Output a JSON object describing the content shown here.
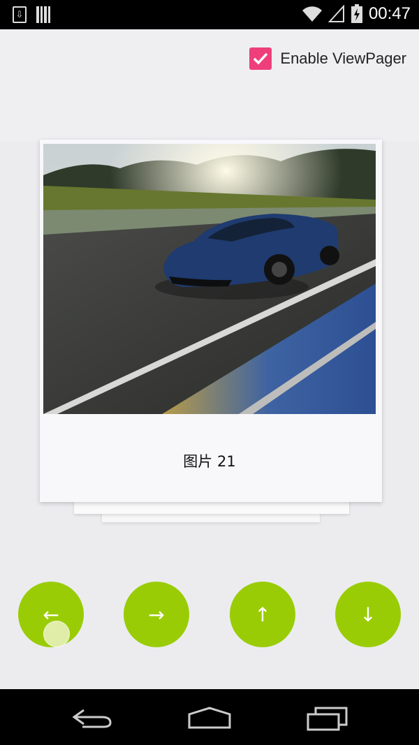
{
  "status_bar": {
    "time": "00:47",
    "icons": [
      "download-icon",
      "sd-card-icon",
      "wifi-icon",
      "signal-icon",
      "battery-charging-icon"
    ]
  },
  "toggle": {
    "label": "Enable ViewPager",
    "checked": true,
    "color": "#ee3f7b"
  },
  "card": {
    "caption": "图片 21",
    "image": "car-photo"
  },
  "buttons": [
    {
      "name": "left-arrow-button",
      "glyph": "←"
    },
    {
      "name": "right-arrow-button",
      "glyph": "→"
    },
    {
      "name": "up-arrow-button",
      "glyph": "↑"
    },
    {
      "name": "down-arrow-button",
      "glyph": "↓"
    }
  ],
  "accent_color": "#9acc06",
  "nav_bar": {
    "icons": [
      "back-icon",
      "home-icon",
      "recents-icon"
    ]
  }
}
